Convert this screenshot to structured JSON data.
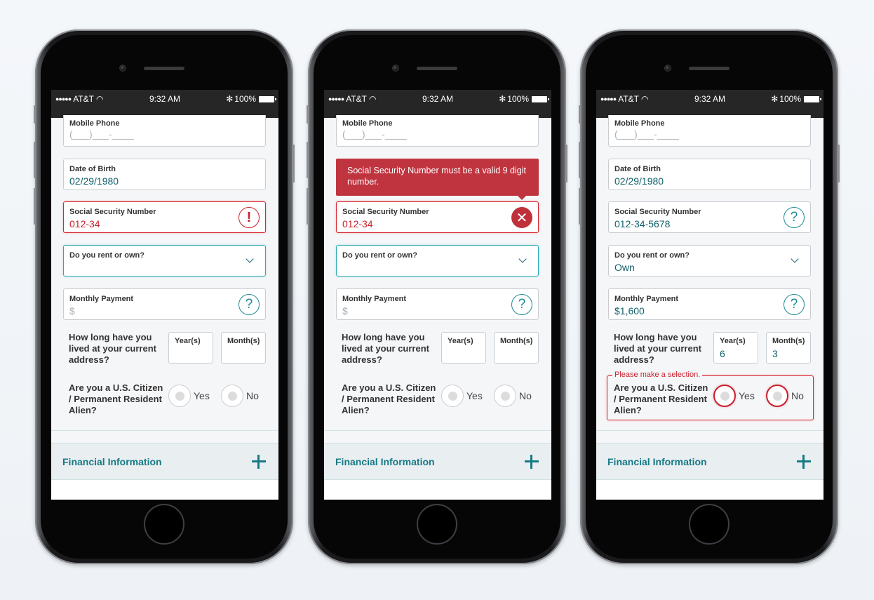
{
  "status_bar": {
    "signal": "●●●●●",
    "carrier": "AT&T",
    "time": "9:32 AM",
    "bluetooth": "✻",
    "battery": "100%"
  },
  "phones": [
    {
      "state": "inline-error",
      "mobile_phone": {
        "label": "Mobile Phone",
        "placeholder": "(___)___-____"
      },
      "dob": {
        "label": "Date of Birth",
        "value": "02/29/1980"
      },
      "ssn": {
        "label": "Social Security Number",
        "value": "012-34",
        "icon": "!"
      },
      "rent_own": {
        "label": "Do you rent or own?",
        "value": ""
      },
      "monthly_payment": {
        "label": "Monthly Payment",
        "placeholder": "$",
        "icon": "?"
      },
      "residence": {
        "question": "How long have you lived at your current address?",
        "years_label": "Year(s)",
        "years_value": "",
        "months_label": "Month(s)",
        "months_value": ""
      },
      "citizen": {
        "question": "Are you a U.S. Citizen / Permanent Resident Alien?",
        "yes": "Yes",
        "no": "No"
      },
      "accordion": {
        "title": "Financial Information"
      }
    },
    {
      "state": "tooltip-error",
      "tooltip": "Social Security Number must be a valid 9 digit number.",
      "mobile_phone": {
        "label": "Mobile Phone",
        "placeholder": "(___)___-____"
      },
      "ssn": {
        "label": "Social Security Number",
        "value": "012-34",
        "icon": "✕"
      },
      "rent_own": {
        "label": "Do you rent or own?",
        "value": ""
      },
      "monthly_payment": {
        "label": "Monthly Payment",
        "placeholder": "$",
        "icon": "?"
      },
      "residence": {
        "question": "How long have you lived at your current address?",
        "years_label": "Year(s)",
        "years_value": "",
        "months_label": "Month(s)",
        "months_value": ""
      },
      "citizen": {
        "question": "Are you a U.S. Citizen / Permanent Resident Alien?",
        "yes": "Yes",
        "no": "No"
      },
      "accordion": {
        "title": "Financial Information"
      }
    },
    {
      "state": "selection-error",
      "mobile_phone": {
        "label": "Mobile Phone",
        "placeholder": "(___)___-____"
      },
      "dob": {
        "label": "Date of Birth",
        "value": "02/29/1980"
      },
      "ssn": {
        "label": "Social Security Number",
        "value": "012-34-5678",
        "icon": "?"
      },
      "rent_own": {
        "label": "Do you rent or own?",
        "value": "Own"
      },
      "monthly_payment": {
        "label": "Monthly Payment",
        "value": "$1,600",
        "icon": "?"
      },
      "residence": {
        "question": "How long have you lived at your current address?",
        "years_label": "Year(s)",
        "years_value": "6",
        "months_label": "Month(s)",
        "months_value": "3"
      },
      "citizen": {
        "question": "Are you a U.S. Citizen / Permanent Resident Alien?",
        "yes": "Yes",
        "no": "No",
        "error": "Please make a selection."
      },
      "accordion": {
        "title": "Financial Information"
      }
    }
  ],
  "colors": {
    "teal": "#157a85",
    "error_red": "#c8202b",
    "focus_teal": "#2aa8b3"
  }
}
